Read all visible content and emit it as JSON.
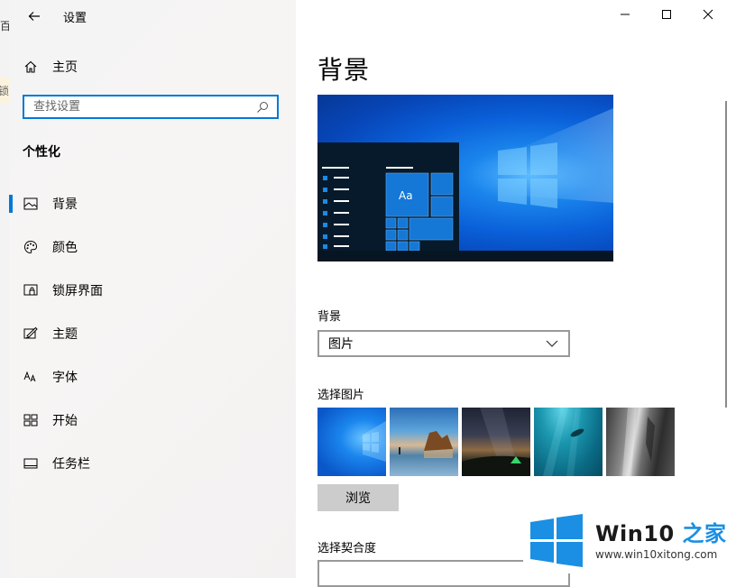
{
  "background_app": {
    "fragment_top": "百",
    "fragment_banner": "锁"
  },
  "window": {
    "title": "设置",
    "controls": {
      "minimize": "—",
      "maximize": "☐",
      "close": "✕"
    }
  },
  "sidebar": {
    "home_label": "主页",
    "search": {
      "placeholder": "查找设置",
      "value": ""
    },
    "section_title": "个性化",
    "items": [
      {
        "label": "背景",
        "icon": "image-icon",
        "active": true
      },
      {
        "label": "颜色",
        "icon": "palette-icon",
        "active": false
      },
      {
        "label": "锁屏界面",
        "icon": "lock-screen-icon",
        "active": false
      },
      {
        "label": "主题",
        "icon": "theme-icon",
        "active": false
      },
      {
        "label": "字体",
        "icon": "font-icon",
        "active": false
      },
      {
        "label": "开始",
        "icon": "start-icon",
        "active": false
      },
      {
        "label": "任务栏",
        "icon": "taskbar-icon",
        "active": false
      }
    ]
  },
  "main": {
    "page_title": "背景",
    "preview_tile_text": "Aa",
    "background_label": "背景",
    "background_select": {
      "value": "图片"
    },
    "choose_picture_label": "选择图片",
    "pictures": [
      "windows-blue",
      "beach-rock",
      "night-sky-tent",
      "underwater-swimmer",
      "rock-cliff"
    ],
    "browse_label": "浏览",
    "fit_label": "选择契合度"
  },
  "watermark": {
    "brand_prefix": "Win10",
    "brand_suffix": " 之家",
    "url": "www.win10xitong.com"
  },
  "colors": {
    "accent": "#0078d7",
    "sidebar_bg": "#f4f4f4",
    "button_bg": "#cccccc",
    "watermark_blue": "#1a8fe3"
  }
}
